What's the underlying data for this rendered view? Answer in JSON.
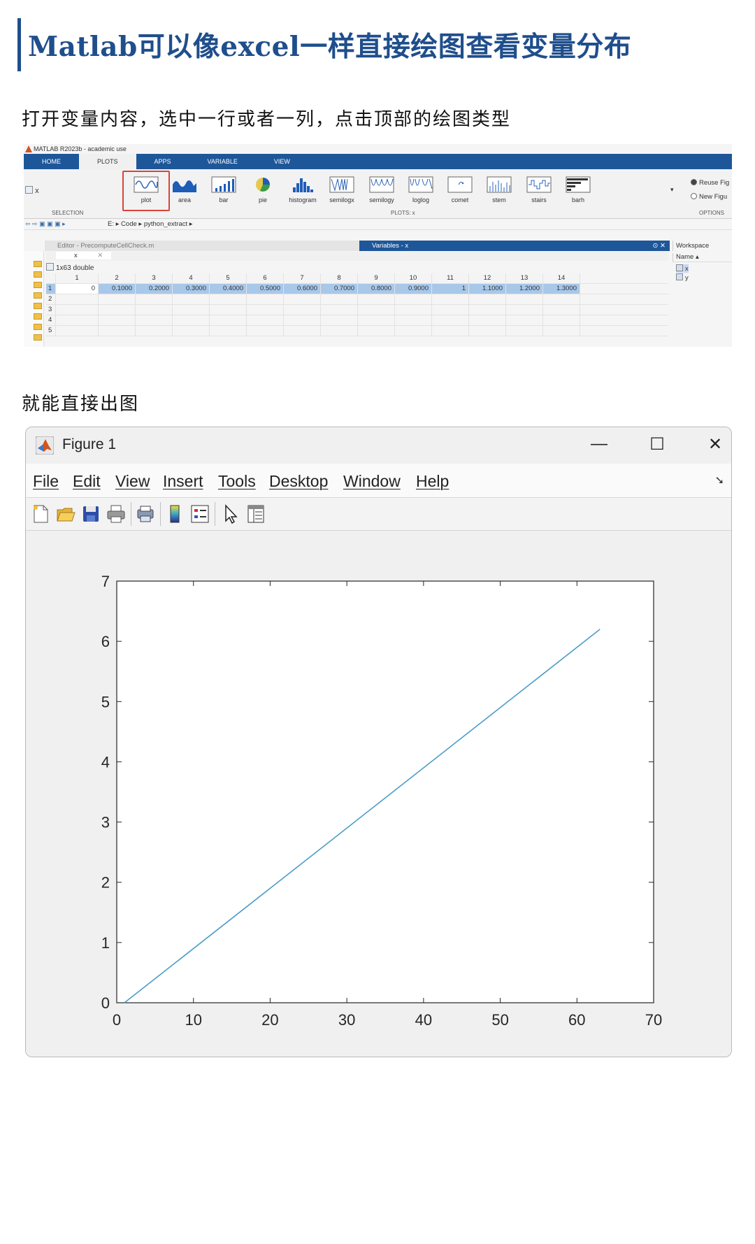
{
  "heading": "Matlab可以像excel一样直接绘图查看变量分布",
  "para1": "打开变量内容，选中一行或者一列，点击顶部的绘图类型",
  "para2": "就能直接出图",
  "matlab": {
    "window_title": "MATLAB R2023b - academic use",
    "tabs": [
      "HOME",
      "PLOTS",
      "APPS",
      "VARIABLE",
      "VIEW"
    ],
    "active_tab": "PLOTS",
    "selection_var": "x",
    "section_selection": "SELECTION",
    "section_plots": "PLOTS: x",
    "section_options": "OPTIONS",
    "plot_types": [
      "plot",
      "area",
      "bar",
      "pie",
      "histogram",
      "semilogx",
      "semilogy",
      "loglog",
      "comet",
      "stem",
      "stairs",
      "barh"
    ],
    "active_plot_type": "plot",
    "options": [
      "Reuse Fig",
      "New Figu"
    ],
    "path": [
      "E:",
      "Code",
      "python_extract"
    ],
    "editor_title": "Editor - PrecomputeCellCheck.m",
    "variables_title": "Variables - x",
    "variable_tab": "x",
    "dims": "1x63 double",
    "col_headers": [
      "1",
      "2",
      "3",
      "4",
      "5",
      "6",
      "7",
      "8",
      "9",
      "10",
      "11",
      "12",
      "13",
      "14"
    ],
    "row_headers": [
      "1",
      "2",
      "3",
      "4",
      "5"
    ],
    "row1_values": [
      "0",
      "0.1000",
      "0.2000",
      "0.3000",
      "0.4000",
      "0.5000",
      "0.6000",
      "0.7000",
      "0.8000",
      "0.9000",
      "1",
      "1.1000",
      "1.2000",
      "1.3000"
    ],
    "workspace_title": "Workspace",
    "workspace_name_header": "Name ▴",
    "workspace_vars": [
      "x",
      "y"
    ]
  },
  "figure": {
    "title": "Figure 1",
    "menus": [
      "File",
      "Edit",
      "View",
      "Insert",
      "Tools",
      "Desktop",
      "Window",
      "Help"
    ],
    "toolbar_icons": [
      "new-file-icon",
      "open-folder-icon",
      "save-icon",
      "print-icon",
      "print-preview-icon",
      "colorbar-icon",
      "legend-icon",
      "pointer-icon",
      "property-inspector-icon"
    ],
    "line_color": "#4a9ec9"
  },
  "chart_data": {
    "type": "line",
    "x": [
      1,
      63
    ],
    "y": [
      0,
      6.2
    ],
    "xlim": [
      0,
      70
    ],
    "ylim": [
      0,
      7
    ],
    "xticks": [
      0,
      10,
      20,
      30,
      40,
      50,
      60,
      70
    ],
    "yticks": [
      0,
      1,
      2,
      3,
      4,
      5,
      6,
      7
    ],
    "grid": false
  }
}
